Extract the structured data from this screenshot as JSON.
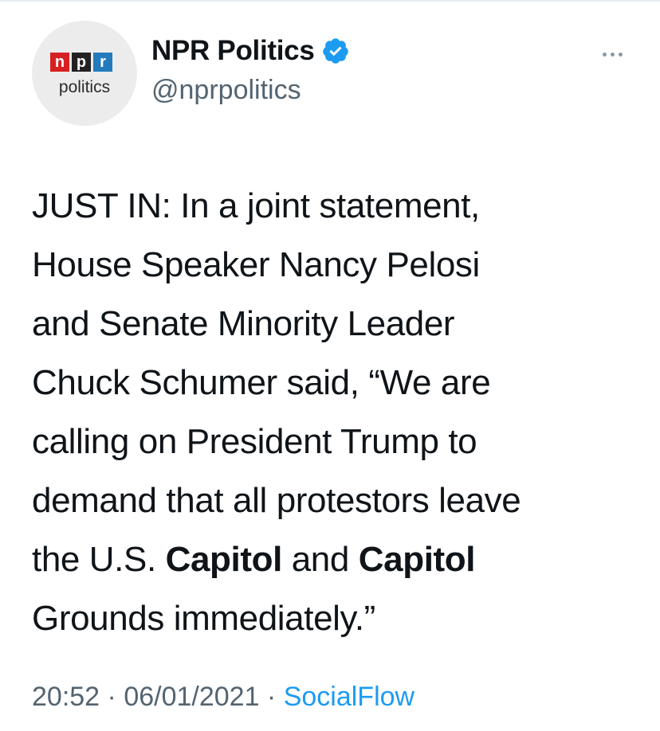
{
  "header": {
    "avatar": {
      "logo_letters": [
        "n",
        "p",
        "r"
      ],
      "logo_colors": [
        "#d62021",
        "#222222",
        "#237bbd"
      ],
      "caption": "politics"
    },
    "display_name": "NPR Politics",
    "verified_icon": "verified-badge-icon",
    "verified_color": "#1d9bf0",
    "handle": "@nprpolitics",
    "more_icon": "more-options-icon"
  },
  "tweet": {
    "lines": [
      {
        "segments": [
          {
            "text": "JUST IN: In a joint statement,",
            "bold": false
          }
        ]
      },
      {
        "segments": [
          {
            "text": "House Speaker Nancy Pelosi",
            "bold": false
          }
        ]
      },
      {
        "segments": [
          {
            "text": "and Senate Minority Leader",
            "bold": false
          }
        ]
      },
      {
        "segments": [
          {
            "text": "Chuck Schumer said, “We are",
            "bold": false
          }
        ]
      },
      {
        "segments": [
          {
            "text": "calling on President Trump to",
            "bold": false
          }
        ]
      },
      {
        "segments": [
          {
            "text": "demand that all protestors leave",
            "bold": false
          }
        ]
      },
      {
        "segments": [
          {
            "text": "the U.S. ",
            "bold": false
          },
          {
            "text": "Capitol",
            "bold": true
          },
          {
            "text": " and ",
            "bold": false
          },
          {
            "text": "Capitol",
            "bold": true
          }
        ]
      },
      {
        "segments": [
          {
            "text": "Grounds immediately.”",
            "bold": false
          }
        ]
      }
    ]
  },
  "meta": {
    "time": "20:52",
    "separator": " · ",
    "date": "06/01/2021",
    "separator2": " · ",
    "source": "SocialFlow"
  },
  "colors": {
    "text": "#0f1419",
    "secondary": "#536471",
    "link": "#1d9bf0"
  }
}
